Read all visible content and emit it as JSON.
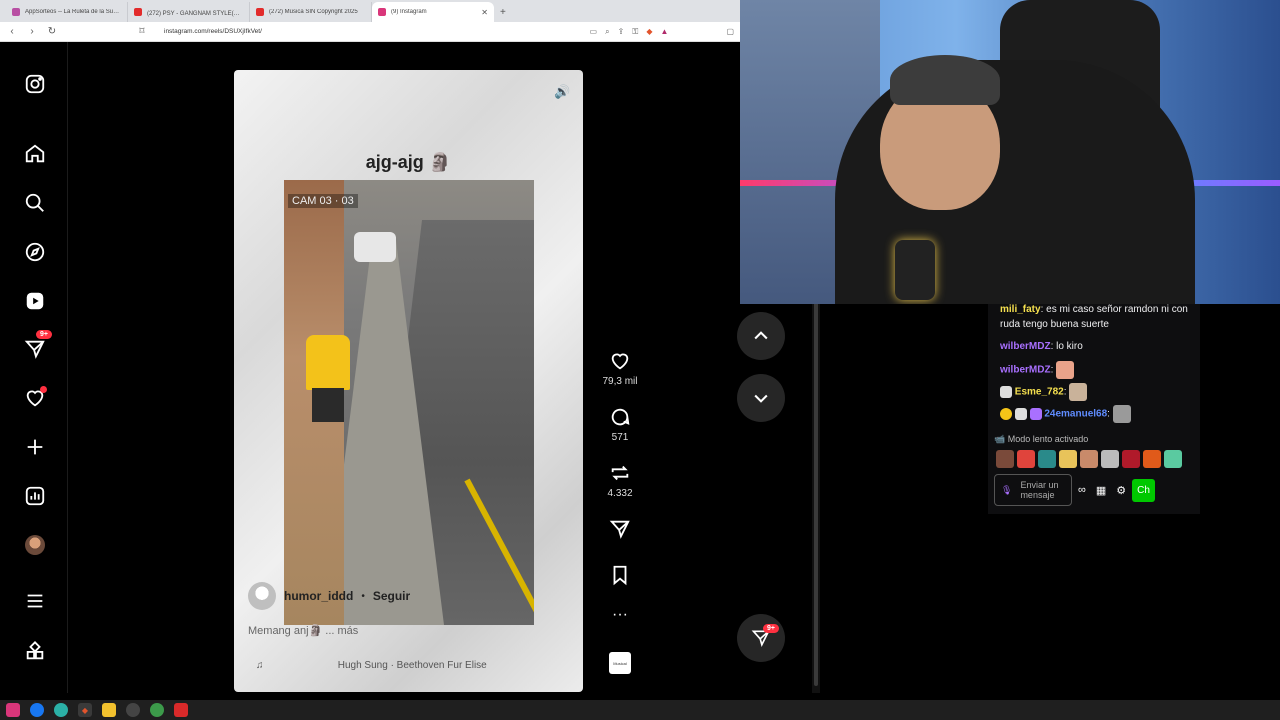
{
  "browser": {
    "tabs": [
      {
        "title": "AppSorteos -- La Ruleta de la Suerte",
        "icon_color": "#b84fa3"
      },
      {
        "title": "(272) PSY - GANGNAM STYLE(강남",
        "icon_color": "#e22b2b"
      },
      {
        "title": "(272) Música SIN Copyright 2025",
        "icon_color": "#e22b2b"
      },
      {
        "title": "(9) Instagram",
        "icon_color": "#d9367a"
      }
    ],
    "url": "instagram.com/reels/DSUXjIfkVet/"
  },
  "instagram": {
    "reel": {
      "title": "ajg-ajg 🗿",
      "cam_label": "CAM 03 · 03",
      "author": "humor_iddd",
      "separator": "•",
      "follow_label": "Seguir",
      "caption": "Memang anj🗿 ... más",
      "music_note": "♫",
      "music": "Hugh Sung · Beethoven Fur Elise"
    },
    "likes": "79,3 mil",
    "comments": "571",
    "reposts": "4.332",
    "more": "···",
    "audio_thumb": "Musical",
    "badges": {
      "messages": "9+",
      "dm_float": "9+"
    }
  },
  "chat": {
    "messages": [
      {
        "user": "mili_faty",
        "text": ": es mi caso señor ramdon ni con ruda tengo buena suerte"
      },
      {
        "user": "wilberMDZ",
        "text": ": lo kiro"
      },
      {
        "user": "wilberMDZ",
        "text": ":"
      },
      {
        "user": "Esme_782",
        "text": ":"
      },
      {
        "user": "24emanuel68",
        "text": ":"
      }
    ],
    "slow_mode": "Modo lento activado",
    "input_placeholder": "Enviar un mensaje",
    "send_label": "Ch"
  },
  "colors": {
    "ig_bg": "#000000",
    "chat_bg": "#0e0e10",
    "accent": "#ff3040",
    "twitch_purple": "#a970ff"
  }
}
